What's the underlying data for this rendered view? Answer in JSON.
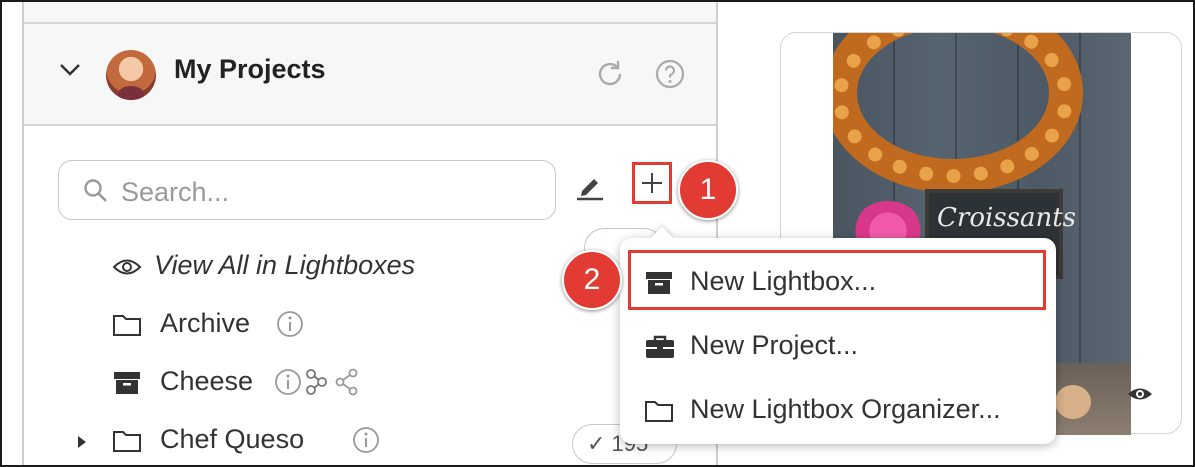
{
  "header": {
    "title": "My Projects"
  },
  "search": {
    "placeholder": "Search..."
  },
  "tree": {
    "view_all": "View All in Lightboxes",
    "items": [
      {
        "label": "Archive"
      },
      {
        "label": "Cheese"
      },
      {
        "label": "Chef Queso",
        "badge": "✓ 195"
      }
    ]
  },
  "menu": {
    "items": [
      {
        "label": "New Lightbox...",
        "icon": "archive-box-icon"
      },
      {
        "label": "New Project...",
        "icon": "briefcase-icon"
      },
      {
        "label": "New Lightbox Organizer...",
        "icon": "folder-icon"
      }
    ]
  },
  "callouts": {
    "step1": "1",
    "step2": "2"
  },
  "photo": {
    "chalkboard_text": "Croissants"
  },
  "colors": {
    "accent": "#e23b33",
    "header_bg": "#f7f7f7"
  }
}
